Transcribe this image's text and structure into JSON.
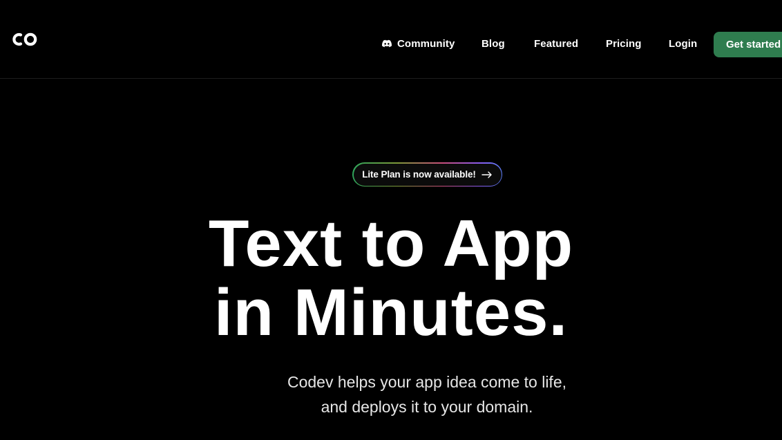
{
  "header": {
    "logo_icon": "codev-co-logo",
    "nav": {
      "community": "Community",
      "blog": "Blog",
      "featured": "Featured",
      "pricing": "Pricing",
      "login": "Login"
    },
    "cta_label": "Get started →"
  },
  "announcement": {
    "label": "Lite Plan is now available!",
    "icon": "arrow-right-icon"
  },
  "hero": {
    "title_line1": "Text to App",
    "title_line2": "in Minutes.",
    "subtitle_line1": "Codev helps your app idea come to life,",
    "subtitle_line2": "and deploys it to your domain."
  },
  "colors": {
    "background": "#000000",
    "accent_green": "#2f7d4f"
  }
}
